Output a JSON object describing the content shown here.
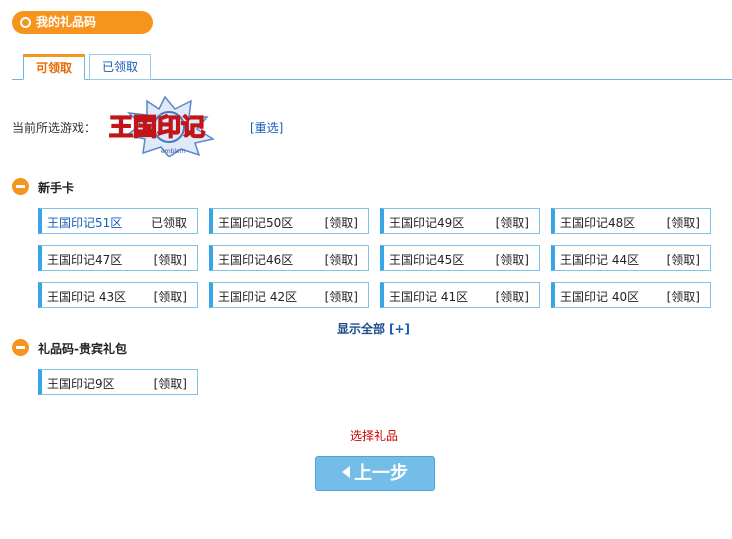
{
  "header": {
    "title": "我的礼品码"
  },
  "tabs": [
    {
      "label": "可领取"
    },
    {
      "label": "已领取"
    }
  ],
  "game": {
    "current_label": "当前所选游戏：",
    "logo_text": "王国印记",
    "reselect": "[重选]"
  },
  "sections": {
    "newbie": {
      "title": "新手卡",
      "items": [
        {
          "name": "王国印记51区",
          "action": "已领取"
        },
        {
          "name": "王国印记50区",
          "action": "[领取]"
        },
        {
          "name": "王国印记49区",
          "action": "[领取]"
        },
        {
          "name": "王国印记48区",
          "action": "[领取]"
        },
        {
          "name": "王国印记47区",
          "action": "[领取]"
        },
        {
          "name": "王国印记46区",
          "action": "[领取]"
        },
        {
          "name": "王国印记45区",
          "action": "[领取]"
        },
        {
          "name": "王国印记 44区",
          "action": "[领取]"
        },
        {
          "name": "王国印记 43区",
          "action": "[领取]"
        },
        {
          "name": "王国印记 42区",
          "action": "[领取]"
        },
        {
          "name": "王国印记 41区",
          "action": "[领取]"
        },
        {
          "name": "王国印记 40区",
          "action": "[领取]"
        }
      ],
      "show_all": "显示全部",
      "show_all_plus": "[+]"
    },
    "vip": {
      "title": "礼品码-贵宾礼包",
      "items": [
        {
          "name": "王国印记9区",
          "action": "[领取]"
        }
      ]
    }
  },
  "footer": {
    "choose_gift": "选择礼品",
    "prev_button": "上一步"
  }
}
